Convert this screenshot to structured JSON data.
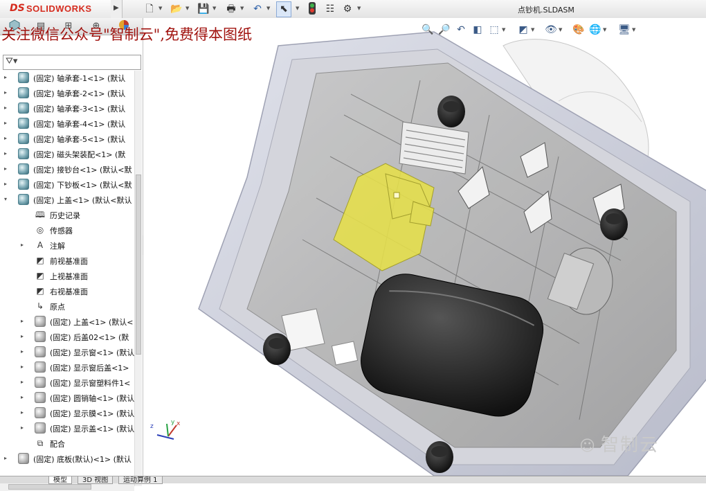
{
  "app": {
    "logo_prefix": "DS",
    "logo_text": "SOLIDWORKS",
    "document_title": "点钞机.SLDASM"
  },
  "toolbar": {
    "icons": [
      "new-document-icon",
      "open-icon",
      "save-icon",
      "print-icon",
      "undo-icon",
      "select-icon",
      "rebuild-icon",
      "file-properties-icon",
      "options-icon"
    ]
  },
  "watermark": {
    "top_text": "关注微信公众号\"智制云\",免费得本图纸",
    "corner_text": "智制云"
  },
  "tree": {
    "tabs": [
      "featuremanager-tab",
      "propertymanager-tab",
      "configurationmanager-tab",
      "dimxpert-tab",
      "display-manager-tab"
    ],
    "filter_icon": "filter-icon",
    "items": [
      {
        "label": "(固定) 轴承套-1<1> (默认",
        "icon": "part",
        "arrow": "▸",
        "indent": 0
      },
      {
        "label": "(固定) 轴承套-2<1> (默认",
        "icon": "part",
        "arrow": "▸",
        "indent": 0
      },
      {
        "label": "(固定) 轴承套-3<1> (默认",
        "icon": "part",
        "arrow": "▸",
        "indent": 0
      },
      {
        "label": "(固定) 轴承套-4<1> (默认",
        "icon": "part",
        "arrow": "▸",
        "indent": 0
      },
      {
        "label": "(固定) 轴承套-5<1> (默认",
        "icon": "part",
        "arrow": "▸",
        "indent": 0
      },
      {
        "label": "(固定) 磁头架装配<1> (默",
        "icon": "part",
        "arrow": "▸",
        "indent": 0
      },
      {
        "label": "(固定) 接钞台<1> (默认<默",
        "icon": "part",
        "arrow": "▸",
        "indent": 0
      },
      {
        "label": "(固定) 下钞板<1> (默认<默",
        "icon": "part",
        "arrow": "▸",
        "indent": 0
      },
      {
        "label": "(固定) 上盖<1> (默认<默认",
        "icon": "part",
        "arrow": "▾",
        "indent": 0
      },
      {
        "label": "历史记录",
        "icon": "history",
        "arrow": "",
        "indent": 1
      },
      {
        "label": "传感器",
        "icon": "sensor",
        "arrow": "",
        "indent": 1
      },
      {
        "label": "注解",
        "icon": "annotation",
        "arrow": "▸",
        "indent": 1
      },
      {
        "label": "前视基准面",
        "icon": "plane",
        "arrow": "",
        "indent": 1
      },
      {
        "label": "上视基准面",
        "icon": "plane",
        "arrow": "",
        "indent": 1
      },
      {
        "label": "右视基准面",
        "icon": "plane",
        "arrow": "",
        "indent": 1
      },
      {
        "label": "原点",
        "icon": "origin",
        "arrow": "",
        "indent": 1
      },
      {
        "label": "(固定) 上盖<1> (默认<",
        "icon": "grey",
        "arrow": "▸",
        "indent": 1
      },
      {
        "label": "(固定) 后盖02<1> (默",
        "icon": "grey",
        "arrow": "▸",
        "indent": 1
      },
      {
        "label": "(固定) 显示窗<1> (默认",
        "icon": "grey",
        "arrow": "▸",
        "indent": 1
      },
      {
        "label": "(固定) 显示窗后盖<1>",
        "icon": "grey",
        "arrow": "▸",
        "indent": 1
      },
      {
        "label": "(固定) 显示窗塑料件1<",
        "icon": "grey",
        "arrow": "▸",
        "indent": 1
      },
      {
        "label": "(固定) 圆销轴<1> (默认",
        "icon": "grey",
        "arrow": "▸",
        "indent": 1
      },
      {
        "label": "(固定) 显示膜<1> (默认",
        "icon": "grey",
        "arrow": "▸",
        "indent": 1
      },
      {
        "label": "(固定) 显示盖<1> (默认",
        "icon": "grey",
        "arrow": "▸",
        "indent": 1
      },
      {
        "label": "配合",
        "icon": "mates",
        "arrow": "",
        "indent": 1
      },
      {
        "label": "(固定) 底板(默认)<1> (默认",
        "icon": "grey",
        "arrow": "▸",
        "indent": 0
      }
    ]
  },
  "bottom_tabs": [
    "模型",
    "3D 视图",
    "运动算例 1"
  ],
  "heads_up": {
    "icons": [
      "zoom-to-fit-icon",
      "zoom-area-icon",
      "previous-view-icon",
      "section-view-icon",
      "view-orientation-icon",
      "display-style-icon",
      "hide-show-icon",
      "edit-appearance-icon",
      "apply-scene-icon",
      "view-settings-icon"
    ]
  },
  "triad": {
    "x": "x",
    "y": "y",
    "z": "z"
  },
  "colors": {
    "logo_red": "#d52b1e",
    "watermark_red": "#a0120e",
    "highlight_yellow": "#e6e04a",
    "housing": "#c9ccd8"
  }
}
